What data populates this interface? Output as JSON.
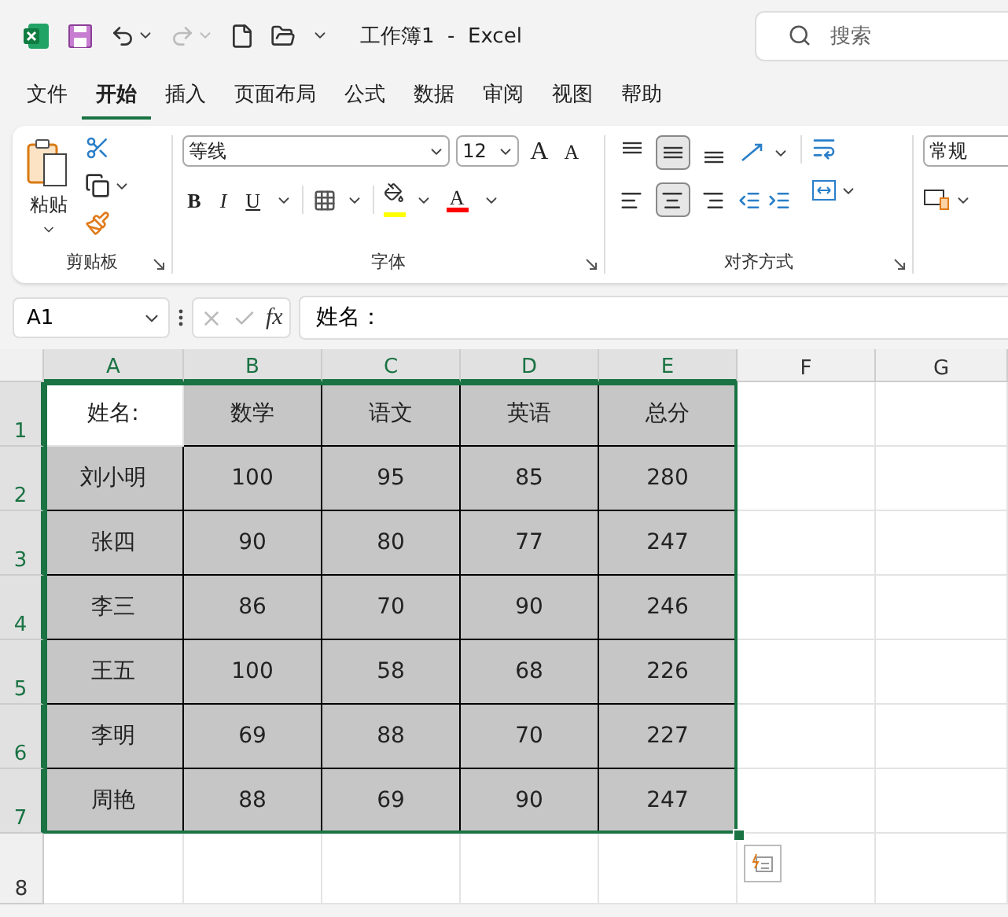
{
  "window": {
    "title": "工作簿1  -  Excel",
    "search": {
      "placeholder": "搜索"
    }
  },
  "tabs": [
    {
      "label": "文件",
      "selected": false
    },
    {
      "label": "开始",
      "selected": true
    },
    {
      "label": "插入",
      "selected": false
    },
    {
      "label": "页面布局",
      "selected": false
    },
    {
      "label": "公式",
      "selected": false
    },
    {
      "label": "数据",
      "selected": false
    },
    {
      "label": "审阅",
      "selected": false
    },
    {
      "label": "视图",
      "selected": false
    },
    {
      "label": "帮助",
      "selected": false
    }
  ],
  "ribbon": {
    "clipboard": {
      "label": "剪贴板",
      "paste": "粘贴"
    },
    "font": {
      "label": "字体",
      "name": "等线",
      "size": "12",
      "grow": "A",
      "shrink": "A",
      "bold": "B",
      "italic": "I",
      "underline": "U",
      "font_color": "A"
    },
    "alignment": {
      "label": "对齐方式",
      "vertical": [
        {
          "kind": "top",
          "selected": false
        },
        {
          "kind": "middle",
          "selected": true
        },
        {
          "kind": "bottom",
          "selected": false
        }
      ],
      "horizontal": [
        {
          "kind": "left",
          "selected": false
        },
        {
          "kind": "center",
          "selected": true
        },
        {
          "kind": "right",
          "selected": false
        }
      ]
    },
    "number": {
      "format": "常规"
    }
  },
  "formula_bar": {
    "name_box": "A1",
    "fx": "fx",
    "value": "姓名："
  },
  "sheet": {
    "columns": [
      {
        "label": "A",
        "selected": true
      },
      {
        "label": "B",
        "selected": true
      },
      {
        "label": "C",
        "selected": true
      },
      {
        "label": "D",
        "selected": true
      },
      {
        "label": "E",
        "selected": true
      },
      {
        "label": "F",
        "selected": false
      },
      {
        "label": "G",
        "selected": false
      }
    ],
    "rows": [
      {
        "number": "1",
        "selected": true,
        "cells": [
          "姓名:",
          "数学",
          "语文",
          "英语",
          "总分"
        ]
      },
      {
        "number": "2",
        "selected": true,
        "cells": [
          "刘小明",
          "100",
          "95",
          "85",
          "280"
        ]
      },
      {
        "number": "3",
        "selected": true,
        "cells": [
          "张四",
          "90",
          "80",
          "77",
          "247"
        ]
      },
      {
        "number": "4",
        "selected": true,
        "cells": [
          "李三",
          "86",
          "70",
          "90",
          "246"
        ]
      },
      {
        "number": "5",
        "selected": true,
        "cells": [
          "王五",
          "100",
          "58",
          "68",
          "226"
        ]
      },
      {
        "number": "6",
        "selected": true,
        "cells": [
          "李明",
          "69",
          "88",
          "70",
          "227"
        ]
      },
      {
        "number": "7",
        "selected": true,
        "cells": [
          "周艳",
          "88",
          "69",
          "90",
          "247"
        ]
      },
      {
        "number": "8",
        "selected": false,
        "cells": []
      }
    ]
  }
}
